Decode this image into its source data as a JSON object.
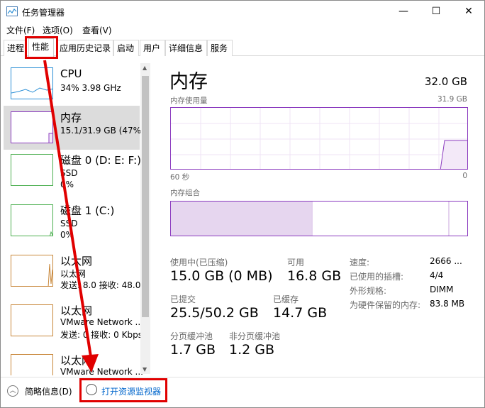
{
  "window": {
    "title": "任务管理器",
    "minimize": "—",
    "maximize": "☐",
    "close": "✕"
  },
  "menu": [
    "文件(F)",
    "选项(O)",
    "查看(V)"
  ],
  "tabs": [
    "进程",
    "性能",
    "应用历史记录",
    "启动",
    "用户",
    "详细信息",
    "服务"
  ],
  "sidebar": [
    {
      "name": "CPU",
      "sub1": "34%  3.98 GHz",
      "sub2": ""
    },
    {
      "name": "内存",
      "sub1": "15.1/31.9 GB (47%)",
      "sub2": ""
    },
    {
      "name": "磁盘 0 (D: E: F:)",
      "sub1": "SSD",
      "sub2": "0%"
    },
    {
      "name": "磁盘 1 (C:)",
      "sub1": "SSD",
      "sub2": "0%"
    },
    {
      "name": "以太网",
      "sub1": "以太网",
      "sub2": "发送: 8.0  接收: 48.0"
    },
    {
      "name": "以太网",
      "sub1": "VMware Network ...",
      "sub2": "发送: 0  接收: 0 Kbps"
    },
    {
      "name": "以太网",
      "sub1": "VMware Network ...",
      "sub2": ""
    }
  ],
  "main": {
    "title": "内存",
    "total": "32.0 GB",
    "usage_label": "内存使用量",
    "usage_max": "31.9 GB",
    "time_left": "60 秒",
    "time_right": "0",
    "composition_label": "内存组合",
    "stats": [
      {
        "label": "使用中(已压缩)",
        "value": "15.0 GB (0 MB)"
      },
      {
        "label": "可用",
        "value": "16.8 GB"
      },
      {
        "label": "已提交",
        "value": "25.5/50.2 GB"
      },
      {
        "label": "已缓存",
        "value": "14.7 GB"
      },
      {
        "label": "分页缓冲池",
        "value": "1.7 GB"
      },
      {
        "label": "非分页缓冲池",
        "value": "1.2 GB"
      }
    ],
    "details": [
      {
        "k": "速度:",
        "v": "2666 ..."
      },
      {
        "k": "已使用的插槽:",
        "v": "4/4"
      },
      {
        "k": "外形规格:",
        "v": "DIMM"
      },
      {
        "k": "为硬件保留的内存:",
        "v": "83.8 MB"
      }
    ]
  },
  "bottom": {
    "brief": "简略信息(D)",
    "monitor": "打开资源监视器"
  },
  "accent": "#8b3bbf",
  "highlight": "#e00000"
}
